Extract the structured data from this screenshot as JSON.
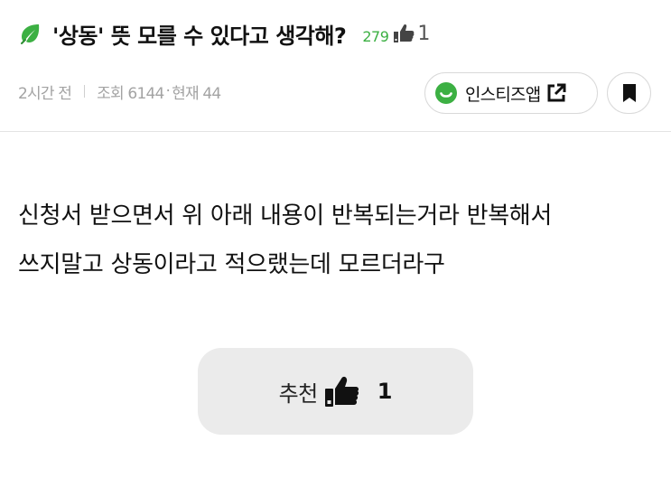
{
  "post": {
    "title": "'상동' 뜻 모를 수 있다고 생각해?",
    "comment_count": "279",
    "like_count": "1",
    "time_ago": "2시간 전",
    "views_label": "조회 6144",
    "current_label": "현재 44",
    "meta_dot": "·"
  },
  "actions": {
    "insta_app_label": "인스티즈앱"
  },
  "body": {
    "lines": [
      "신청서 받으면서 위 아래 내용이 반복되는거라 반복해서",
      "쓰지말고 상동이라고 적으랬는데 모르더라구"
    ]
  },
  "recommend": {
    "label": "추천",
    "count": "1"
  },
  "colors": {
    "accent_green": "#3cb043",
    "meta_gray": "#a3a3a3",
    "button_gray": "#ebebeb"
  },
  "icons": {
    "title_leaf": "leaf-icon",
    "title_thumb": "thumbs-up-icon",
    "insta_logo": "insta-logo-icon",
    "external": "external-link-icon",
    "bookmark": "bookmark-icon",
    "recommend_thumb": "thumbs-up-icon"
  }
}
